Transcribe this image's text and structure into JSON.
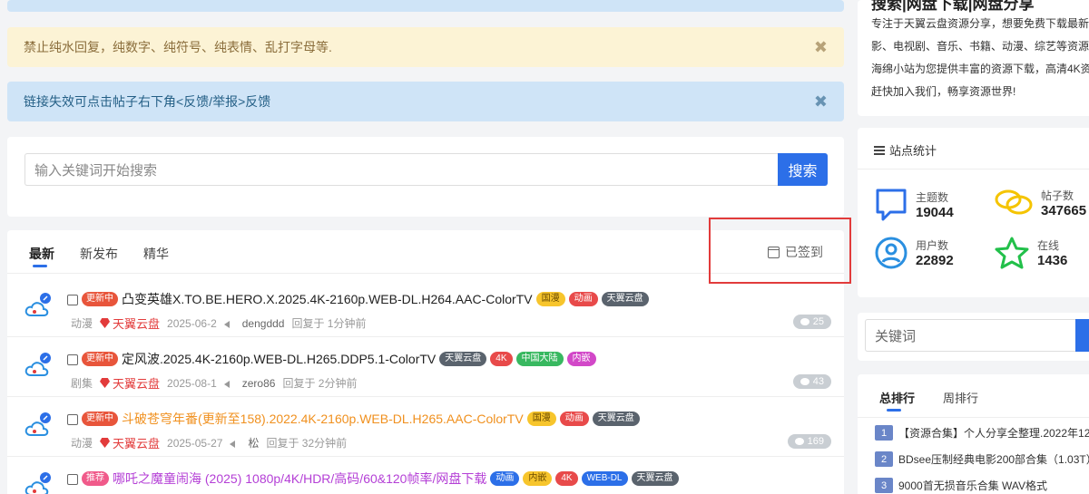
{
  "alerts": {
    "warning": "禁止纯水回复，纯数字、纯符号、纯表情、乱打字母等.",
    "info": "链接失效可点击帖子右下角<反馈/举报>反馈",
    "close": "✖"
  },
  "search": {
    "placeholder": "输入关键词开始搜索",
    "button": "搜索"
  },
  "tabs": [
    "最新",
    "新发布",
    "精华"
  ],
  "signed": "已签到",
  "posts": [
    {
      "badge": "更新中",
      "title": "凸变英雄X.TO.BE.HERO.X.2025.4K-2160p.WEB-DL.H264.AAC-ColorTV",
      "tags": [
        "国漫",
        "动画",
        "天翼云盘"
      ],
      "category": "动漫",
      "forum": "天翼云盘",
      "date": "2025-06-2",
      "user": "dengddd",
      "reply": "回复于 1分钟前",
      "count": "25"
    },
    {
      "badge": "更新中",
      "title": "定风波.2025.4K-2160p.WEB-DL.H265.DDP5.1-ColorTV",
      "tags": [
        "天翼云盘",
        "4K",
        "中国大陆",
        "内嵌"
      ],
      "category": "剧集",
      "forum": "天翼云盘",
      "date": "2025-08-1",
      "user": "zero86",
      "reply": "回复于 2分钟前",
      "count": "43"
    },
    {
      "badge": "更新中",
      "title": "斗破苍穹年番(更新至158).2022.4K-2160p.WEB-DL.H265.AAC-ColorTV",
      "tags": [
        "国漫",
        "动画",
        "天翼云盘"
      ],
      "category": "动漫",
      "forum": "天翼云盘",
      "date": "2025-05-27",
      "user": "松",
      "reply": "回复于 32分钟前",
      "count": "169"
    },
    {
      "badge": "推荐",
      "title": "哪吒之魔童闹海 (2025) 1080p/4K/HDR/高码/60&120帧率/网盘下载",
      "tags": [
        "动画",
        "内嵌",
        "4K",
        "WEB-DL",
        "天翼云盘"
      ]
    }
  ],
  "intro": {
    "title": "搜索|网盘下载|网盘分享",
    "lines": [
      "专注于天翼云盘资源分享，想要免费下载最新",
      "影、电视剧、音乐、书籍、动漫、综艺等资源",
      "海绵小站为您提供丰富的资源下载，高清4K资",
      "赶快加入我们，畅享资源世界!"
    ]
  },
  "stats": {
    "heading": "站点统计",
    "topics_label": "主题数",
    "topics": "19044",
    "posts_label": "帖子数",
    "posts": "347665",
    "users_label": "用户数",
    "users": "22892",
    "online_label": "在线",
    "online": "1436"
  },
  "right_search": {
    "placeholder": "关键词"
  },
  "ranking": {
    "tabs": [
      "总排行",
      "周排行"
    ],
    "items": [
      {
        "n": "1",
        "text": "【资源合集】个人分享全整理.2022年12"
      },
      {
        "n": "2",
        "text": "BDsee压制经典电影200部合集（1.03T）"
      },
      {
        "n": "3",
        "text": "9000首无损音乐合集 WAV格式"
      }
    ]
  },
  "colors": {
    "accent": "#2c6fe8",
    "highlight": "#e23b3b"
  }
}
